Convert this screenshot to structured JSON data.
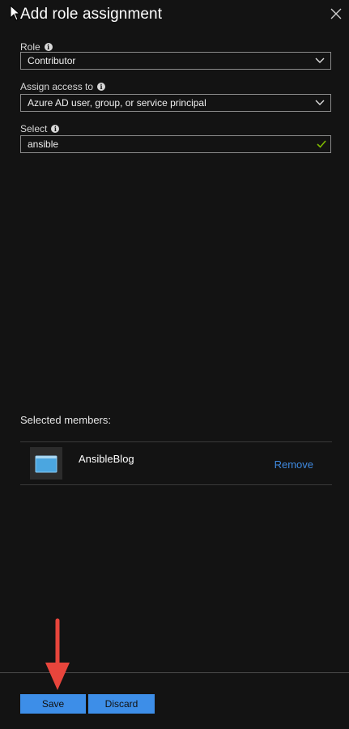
{
  "panel": {
    "title": "Add role assignment"
  },
  "icons": {
    "close": "close-icon",
    "info": "info-icon",
    "dropdown": "chevron-down-icon",
    "valid": "checkmark-icon",
    "pointer": "mouse-cursor-icon",
    "app": "app-window-icon",
    "annotation": "red-arrow-icon"
  },
  "fields": {
    "role": {
      "label": "Role",
      "value": "Contributor"
    },
    "assign_access": {
      "label": "Assign access to",
      "value": "Azure AD user, group, or service principal"
    },
    "select": {
      "label": "Select",
      "value": "ansible"
    }
  },
  "members": {
    "heading": "Selected members:",
    "items": [
      {
        "name": "AnsibleBlog",
        "action": "Remove"
      }
    ]
  },
  "footer": {
    "save_label": "Save",
    "discard_label": "Discard"
  },
  "colors": {
    "background": "#131313",
    "accent": "#3d8ee8",
    "link": "#3f8ae0",
    "valid": "#7fba00",
    "annotation": "#e8453c"
  }
}
